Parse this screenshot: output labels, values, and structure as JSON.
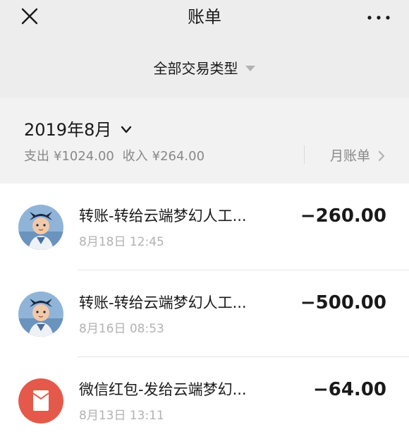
{
  "header": {
    "title": "账单",
    "close_icon": "close-icon",
    "more_icon": "more-icon"
  },
  "filter": {
    "label": "全部交易类型",
    "caret_icon": "caret-down-icon"
  },
  "summary": {
    "month": "2019年8月",
    "expense_label": "支出",
    "expense_value": "¥1024.00",
    "income_label": "收入",
    "income_value": "¥264.00",
    "monthly_bill_label": "月账单",
    "chevron_icon": "chevron-right-icon"
  },
  "transactions": [
    {
      "title": "转账-转给云端梦幻人工...",
      "time": "8月18日 12:45",
      "amount": "−260.00",
      "avatar": "cartoon-avatar"
    },
    {
      "title": "转账-转给云端梦幻人工...",
      "time": "8月16日 08:53",
      "amount": "−500.00",
      "avatar": "cartoon-avatar"
    },
    {
      "title": "微信红包-发给云端梦幻...",
      "time": "8月13日 13:11",
      "amount": "−64.00",
      "avatar": "red-packet-icon"
    }
  ],
  "colors": {
    "header_bg": "#ededed",
    "summary_bg": "#f2f2f2",
    "red_packet": "#e5594a",
    "secondary_text": "#888888"
  }
}
